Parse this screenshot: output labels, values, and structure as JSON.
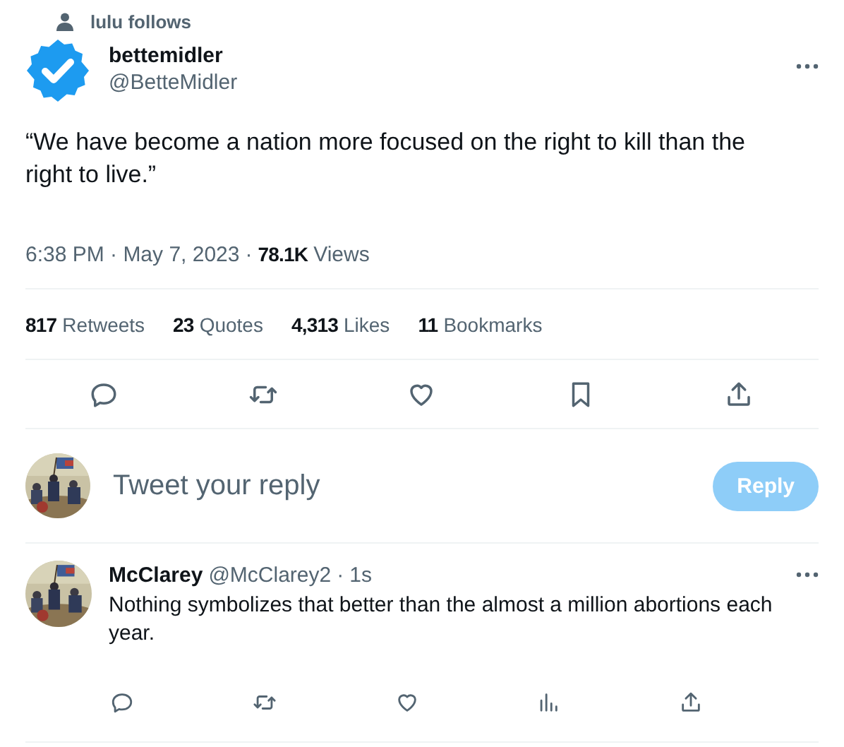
{
  "social_context": {
    "text": "lulu follows"
  },
  "tweet": {
    "author_name": "bettemidler",
    "handle": "@BetteMidler",
    "text": "“We have become a nation more focused on the right to kill than the right to live.”",
    "time": "6:38 PM · May 7, 2023",
    "separator": "·",
    "views_count": "78.1K",
    "views_label": "Views"
  },
  "stats": [
    {
      "count": "817",
      "label": "Retweets"
    },
    {
      "count": "23",
      "label": "Quotes"
    },
    {
      "count": "4,313",
      "label": "Likes"
    },
    {
      "count": "11",
      "label": "Bookmarks"
    }
  ],
  "actions": [
    {
      "kind": "reply"
    },
    {
      "kind": "retweet"
    },
    {
      "kind": "like"
    },
    {
      "kind": "bookmark"
    },
    {
      "kind": "share"
    }
  ],
  "composer": {
    "placeholder": "Tweet your reply",
    "button": "Reply",
    "disabled": true
  },
  "replies": [
    {
      "name": "McClarey",
      "handle": "@McClarey2",
      "separator": "·",
      "time": "1s",
      "text": "Nothing symbolizes that better than the almost a million abortions each year.",
      "actions": [
        {
          "kind": "reply"
        },
        {
          "kind": "retweet"
        },
        {
          "kind": "like"
        },
        {
          "kind": "views"
        },
        {
          "kind": "share"
        }
      ]
    }
  ]
}
